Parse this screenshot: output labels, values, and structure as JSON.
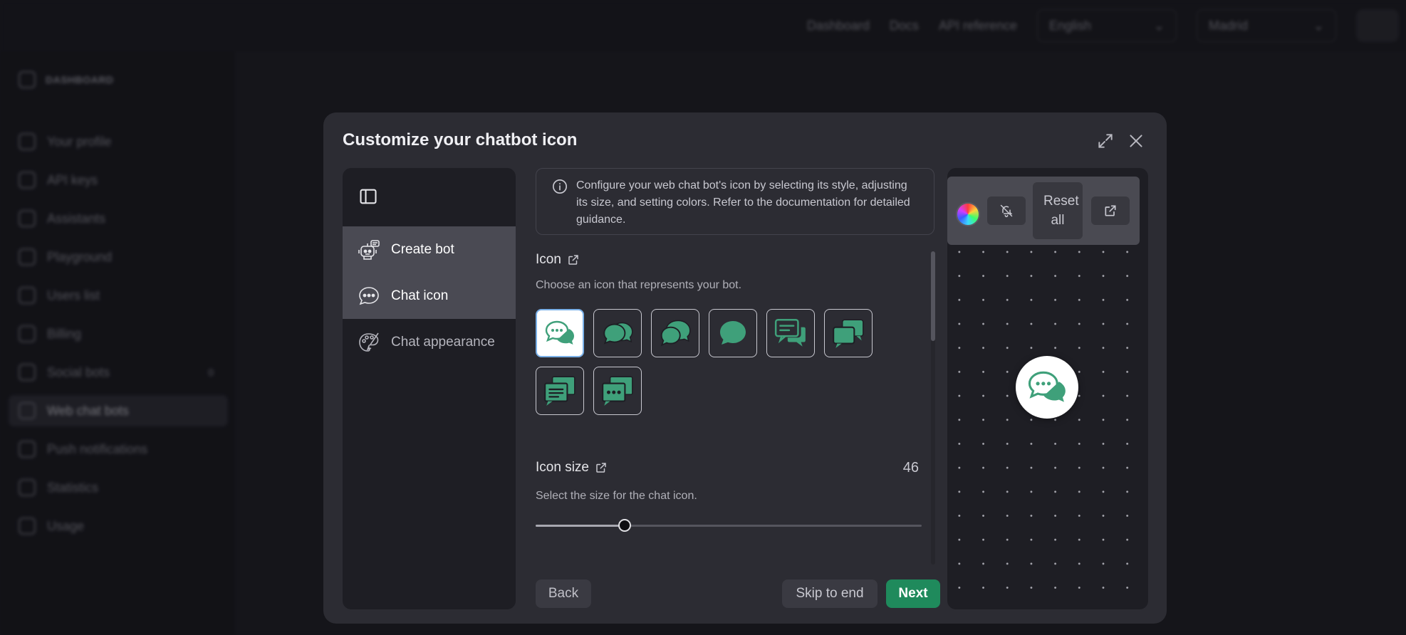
{
  "background": {
    "topnav": {
      "links": [
        "Dashboard",
        "Docs",
        "API reference"
      ],
      "language": "English",
      "location": "Madrid"
    },
    "sidebar": {
      "heading": "DASHBOARD",
      "items": [
        {
          "label": "Your profile",
          "icon": "user-icon"
        },
        {
          "label": "API keys",
          "icon": "key-icon"
        },
        {
          "label": "Assistants",
          "icon": "assistant-icon"
        },
        {
          "label": "Playground",
          "icon": "playground-icon"
        },
        {
          "label": "Users list",
          "icon": "users-icon"
        },
        {
          "label": "Billing",
          "icon": "billing-icon"
        },
        {
          "label": "Social bots",
          "icon": "social-icon",
          "badge": "0"
        },
        {
          "label": "Web chat bots",
          "icon": "webchat-icon",
          "active": true
        },
        {
          "label": "Push notifications",
          "icon": "bell-icon"
        },
        {
          "label": "Statistics",
          "icon": "chart-icon"
        },
        {
          "label": "Usage",
          "icon": "usage-icon"
        }
      ]
    }
  },
  "modal": {
    "title": "Customize your chatbot icon",
    "steps": [
      {
        "label": "Create bot",
        "icon": "robot-icon"
      },
      {
        "label": "Chat icon",
        "icon": "chat-bubble-icon"
      },
      {
        "label": "Chat appearance",
        "icon": "palette-icon"
      }
    ],
    "selected_step": "Chat icon",
    "info": "Configure your web chat bot's icon by selecting its style, adjusting its size, and setting colors. Refer to the documentation for detailed guidance.",
    "icon_section": {
      "title": "Icon",
      "subtitle": "Choose an icon that represents your bot.",
      "options": [
        "chat-dots-double",
        "chat-round-double",
        "chat-round-double-alt",
        "chat-round-single",
        "chat-lines-double",
        "chat-square-double",
        "chat-lines-square",
        "chat-dots-square"
      ],
      "selected_index": 0
    },
    "size_section": {
      "title": "Icon size",
      "subtitle": "Select the size for the chat icon.",
      "value": "46",
      "slider_fraction": 0.23
    },
    "buttons": {
      "back": "Back",
      "skip": "Skip to end",
      "next": "Next"
    },
    "preview": {
      "reset_label": "Reset all"
    }
  },
  "colors": {
    "accent": "#1f8a5c",
    "icon_green": "#3fa07a",
    "modal_bg": "#2c2c33",
    "panel_bg": "#1e1e24"
  }
}
